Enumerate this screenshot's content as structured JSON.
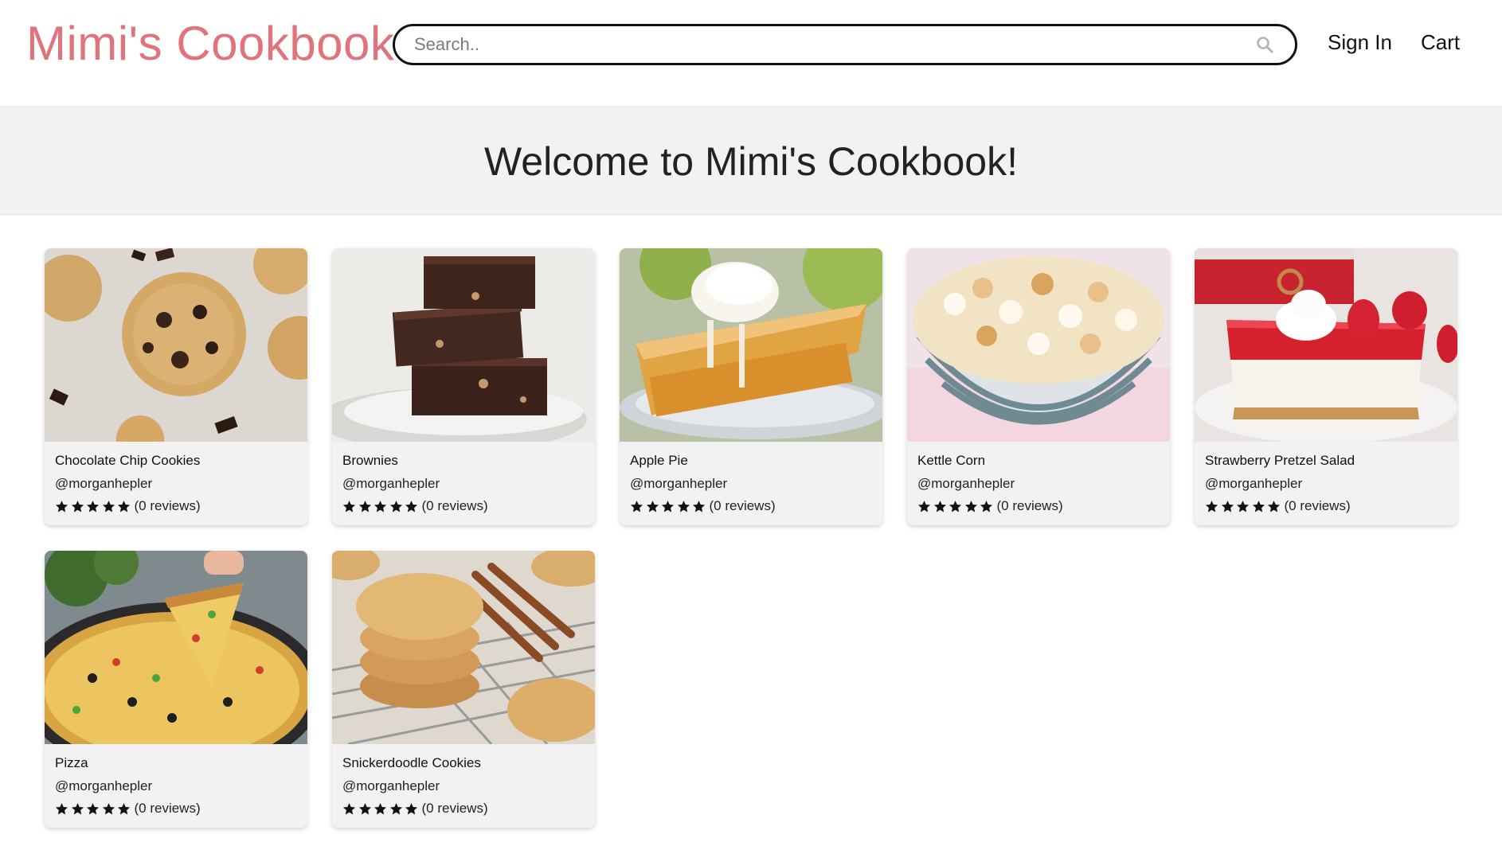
{
  "brand": {
    "title": "Mimi's Cookbook"
  },
  "search": {
    "placeholder": "Search..",
    "value": "",
    "icon": "search-icon"
  },
  "nav": {
    "sign_in": "Sign In",
    "cart": "Cart"
  },
  "hero": {
    "title": "Welcome to Mimi's Cookbook!"
  },
  "recipes": [
    {
      "title": "Chocolate Chip Cookies",
      "author": "@morganhepler",
      "stars": 5,
      "reviews": "(0 reviews)",
      "image": "chocolate-chip-cookies-photo"
    },
    {
      "title": "Brownies",
      "author": "@morganhepler",
      "stars": 5,
      "reviews": "(0 reviews)",
      "image": "brownies-photo"
    },
    {
      "title": "Apple Pie",
      "author": "@morganhepler",
      "stars": 5,
      "reviews": "(0 reviews)",
      "image": "apple-pie-photo"
    },
    {
      "title": "Kettle Corn",
      "author": "@morganhepler",
      "stars": 5,
      "reviews": "(0 reviews)",
      "image": "kettle-corn-photo"
    },
    {
      "title": "Strawberry Pretzel Salad",
      "author": "@morganhepler",
      "stars": 5,
      "reviews": "(0 reviews)",
      "image": "strawberry-pretzel-salad-photo"
    },
    {
      "title": "Pizza",
      "author": "@morganhepler",
      "stars": 5,
      "reviews": "(0 reviews)",
      "image": "pizza-photo"
    },
    {
      "title": "Snickerdoodle Cookies",
      "author": "@morganhepler",
      "stars": 5,
      "reviews": "(0 reviews)",
      "image": "snickerdoodle-cookies-photo"
    }
  ],
  "colors": {
    "brand": "#e0737b",
    "hero_bg": "#f2f2f2",
    "card_bg": "#f2f2f2",
    "star": "#111111"
  }
}
